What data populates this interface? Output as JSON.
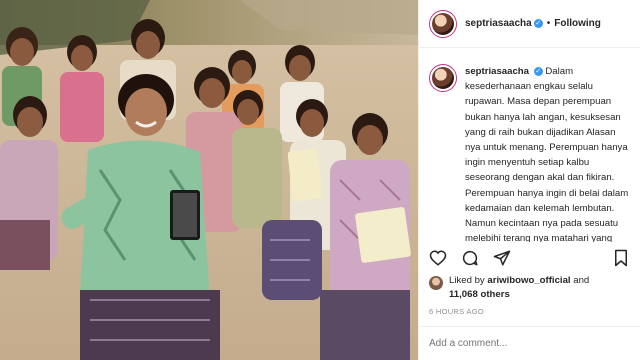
{
  "post": {
    "username": "septriasaacha",
    "follow_separator": "•",
    "follow_label": "Following",
    "caption": "Dalam kesederhanaan engkau selalu rupawan. Masa depan perempuan bukan hanya lah angan, kesuksesan yang di raih bukan dijadikan Alasan nya untuk menang. Perempuan hanya ingin menyentuh setiap kalbu seseorang dengan akal dan fikiran. Perempuan hanya ingin di belai dalam kedamaian dan kelemah lembutan. Namun kecintaan nya pada sesuatu melebihi terang nya matahari yang dirinya songsong setiap Pagi. Harapan",
    "liked_prefix": "Liked by",
    "liked_user": "ariwibowo_official",
    "liked_and": "and",
    "liked_others": "11,068 others",
    "time": "6 HOURS AGO",
    "comment_placeholder": "Add a comment..."
  },
  "icons": {
    "verified": "verified-badge-icon",
    "like": "heart-icon",
    "comment": "comment-icon",
    "share": "share-icon",
    "save": "bookmark-icon"
  },
  "colors": {
    "verified": "#3897f0",
    "text": "#262626",
    "muted": "#8e8e8e",
    "border": "#efefef"
  }
}
